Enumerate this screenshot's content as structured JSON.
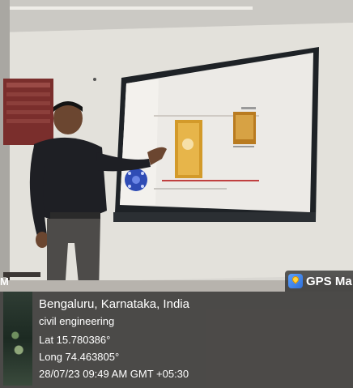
{
  "photo": {
    "description_icons": [
      "map-pin-icon"
    ]
  },
  "gps_overlay": {
    "app_label": "GPS Ma",
    "edge_letter": "M",
    "address": "Bengaluru, Karnataka, India",
    "note": "civil engineering",
    "latitude": "Lat 15.780386°",
    "longitude": "Long 74.463805°",
    "timestamp": "28/07/23 09:49 AM GMT +05:30"
  },
  "colors": {
    "wall": "#e4e2dc",
    "screen_frame": "#1e2226",
    "overlay_bg": "#141414"
  }
}
